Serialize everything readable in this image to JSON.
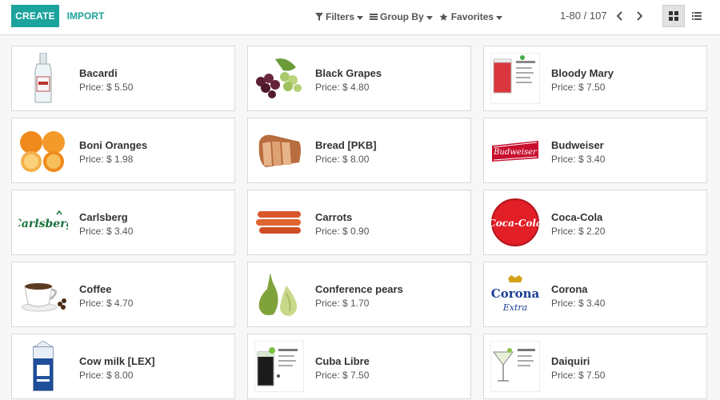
{
  "toolbar": {
    "create_label": "CREATE",
    "import_label": "IMPORT",
    "filters_label": "Filters",
    "groupby_label": "Group By",
    "favorites_label": "Favorites",
    "pager_text": "1-80 / 107"
  },
  "colors": {
    "accent": "#1ba39c"
  },
  "products": [
    {
      "name": "Bacardi",
      "price": "Price: $ 5.50",
      "icon": "bottle-icon"
    },
    {
      "name": "Black Grapes",
      "price": "Price: $ 4.80",
      "icon": "grapes-icon"
    },
    {
      "name": "Bloody Mary",
      "price": "Price: $ 7.50",
      "icon": "cocktail-recipe-icon"
    },
    {
      "name": "Boni Oranges",
      "price": "Price: $ 1.98",
      "icon": "oranges-icon"
    },
    {
      "name": "Bread [PKB]",
      "price": "Price: $ 8.00",
      "icon": "bread-icon"
    },
    {
      "name": "Budweiser",
      "price": "Price: $ 3.40",
      "icon": "budweiser-logo-icon"
    },
    {
      "name": "Carlsberg",
      "price": "Price: $ 3.40",
      "icon": "carlsberg-logo-icon"
    },
    {
      "name": "Carrots",
      "price": "Price: $ 0.90",
      "icon": "carrots-icon"
    },
    {
      "name": "Coca-Cola",
      "price": "Price: $ 2.20",
      "icon": "coca-cola-logo-icon"
    },
    {
      "name": "Coffee",
      "price": "Price: $ 4.70",
      "icon": "coffee-cup-icon"
    },
    {
      "name": "Conference pears",
      "price": "Price: $ 1.70",
      "icon": "pears-icon"
    },
    {
      "name": "Corona",
      "price": "Price: $ 3.40",
      "icon": "corona-logo-icon"
    },
    {
      "name": "Cow milk [LEX]",
      "price": "Price: $ 8.00",
      "icon": "milk-carton-icon"
    },
    {
      "name": "Cuba Libre",
      "price": "Price: $ 7.50",
      "icon": "cocktail-recipe-icon"
    },
    {
      "name": "Daiquiri",
      "price": "Price: $ 7.50",
      "icon": "martini-glass-icon"
    }
  ]
}
